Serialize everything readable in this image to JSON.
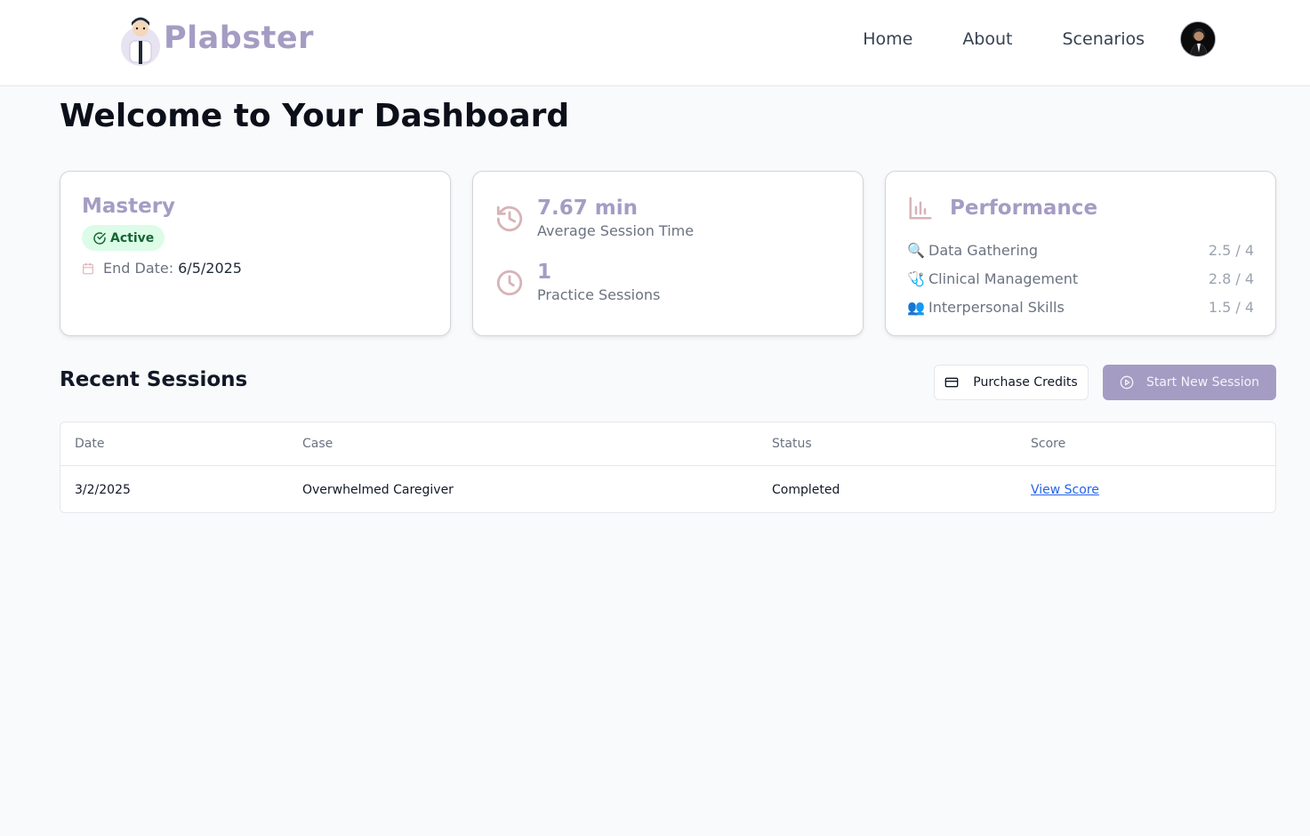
{
  "brand": {
    "name": "Plabster"
  },
  "nav": {
    "items": [
      "Home",
      "About",
      "Scenarios"
    ]
  },
  "page": {
    "title": "Welcome to Your Dashboard"
  },
  "mastery_card": {
    "title": "Mastery",
    "status": "Active",
    "end_label": "End Date:",
    "end_date": "6/5/2025"
  },
  "stats_card": {
    "avg_value": "7.67 min",
    "avg_label": "Average Session Time",
    "sessions_value": "1",
    "sessions_label": "Practice Sessions"
  },
  "performance_card": {
    "title": "Performance",
    "items": [
      {
        "emoji": "🔍",
        "label": "Data Gathering",
        "score": "2.5 / 4"
      },
      {
        "emoji": "🩺",
        "label": "Clinical Management",
        "score": "2.8 / 4"
      },
      {
        "emoji": "👥",
        "label": "Interpersonal Skills",
        "score": "1.5 / 4"
      }
    ]
  },
  "recent": {
    "title": "Recent Sessions",
    "purchase_label": "Purchase Credits",
    "start_label": "Start New Session",
    "columns": [
      "Date",
      "Case",
      "Status",
      "Score"
    ],
    "rows": [
      {
        "date": "3/2/2025",
        "case": "Overwhelmed Caregiver",
        "status": "Completed",
        "score_link": "View Score"
      }
    ]
  },
  "colors": {
    "accent": "#a59cc4",
    "success_bg": "#dcfce7",
    "success_text": "#166534",
    "link": "#2563eb"
  }
}
